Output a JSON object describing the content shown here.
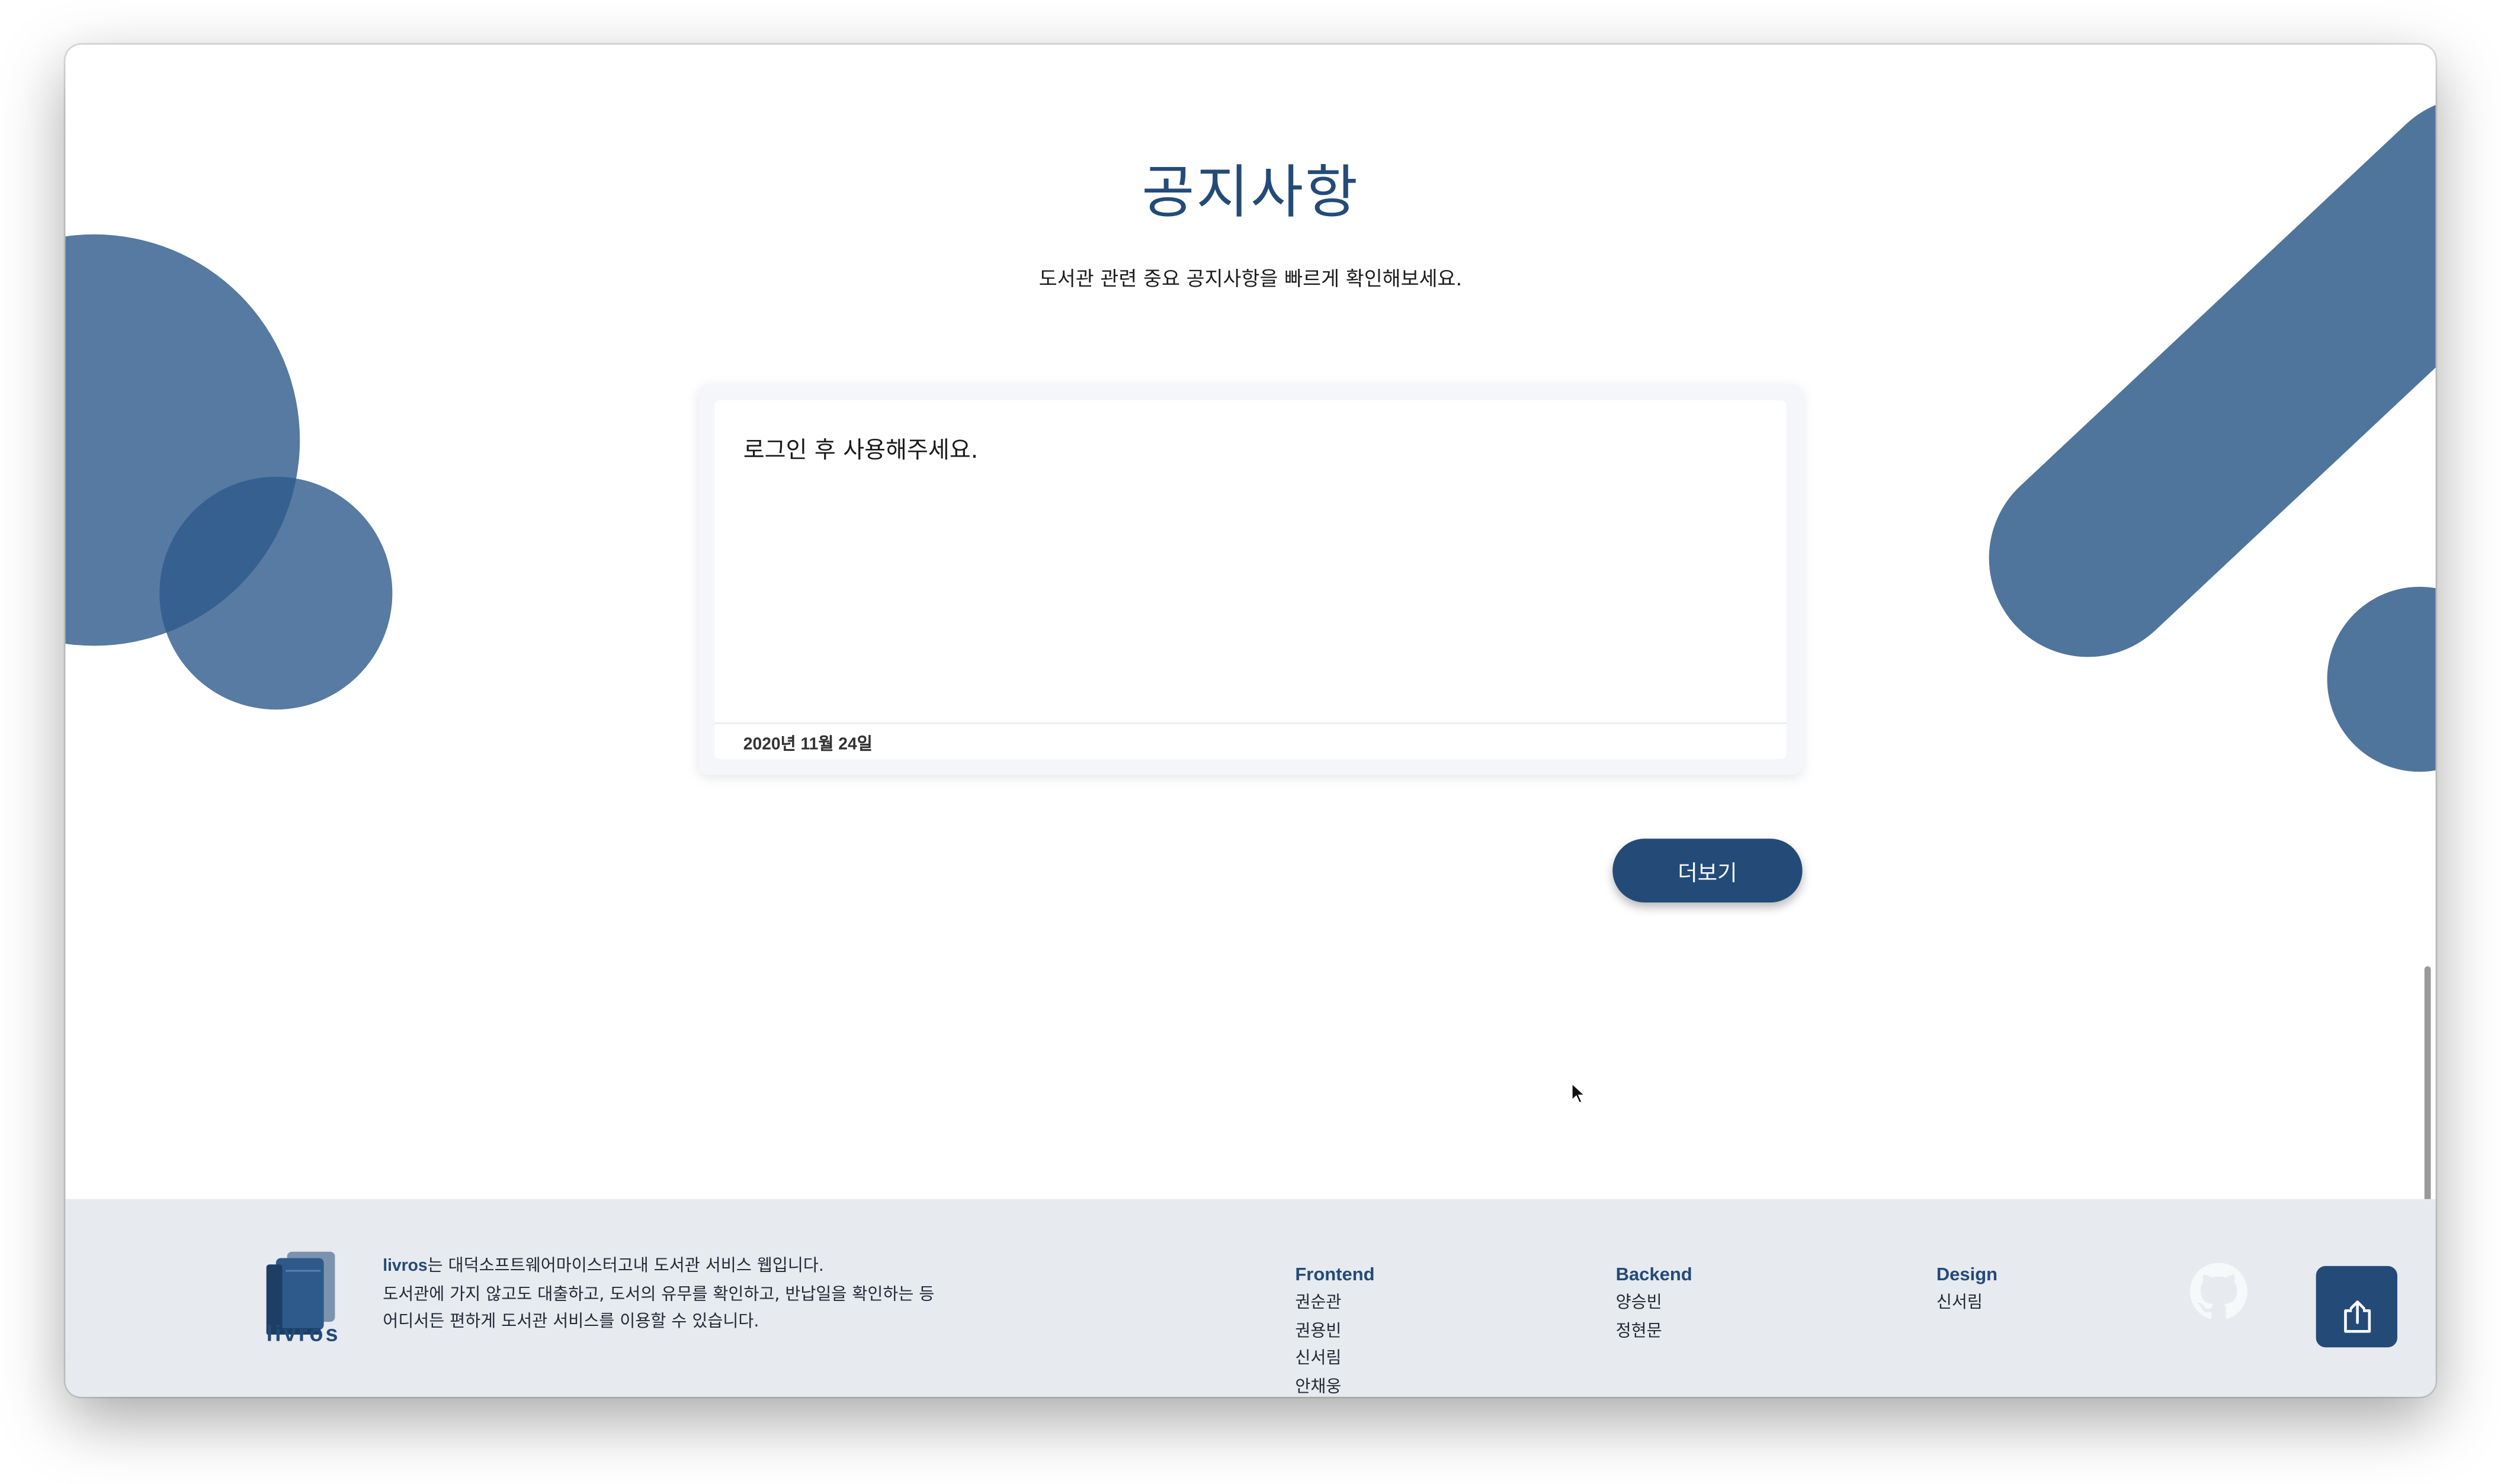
{
  "colors": {
    "primary": "#244b78",
    "decoration": "#4f759d",
    "footer_background": "#e7eaef"
  },
  "notice": {
    "title": "공지사항",
    "subtitle": "도서관 관련 중요 공지사항을 빠르게 확인해보세요.",
    "card": {
      "message": "로그인 후 사용해주세요.",
      "date": "2020년 11월 24일"
    },
    "more_button_label": "더보기"
  },
  "footer": {
    "logo_text": "livros",
    "about": {
      "brand": "livros",
      "line1_suffix": "는 대덕소프트웨어마이스터고내 도서관 서비스 웹입니다.",
      "line2": "도서관에 가지 않고도 대출하고, 도서의 유무를 확인하고, 반납일을 확인하는 등",
      "line3": "어디서든 편하게 도서관 서비스를 이용할 수 있습니다."
    },
    "teams": [
      {
        "title": "Frontend",
        "members": [
          "권순관",
          "권용빈",
          "신서림",
          "안채웅"
        ]
      },
      {
        "title": "Backend",
        "members": [
          "양승빈",
          "정현문"
        ]
      },
      {
        "title": "Design",
        "members": [
          "신서림"
        ]
      }
    ],
    "github_icon": "github-icon",
    "top_button_icon": "arrow-up-icon"
  }
}
